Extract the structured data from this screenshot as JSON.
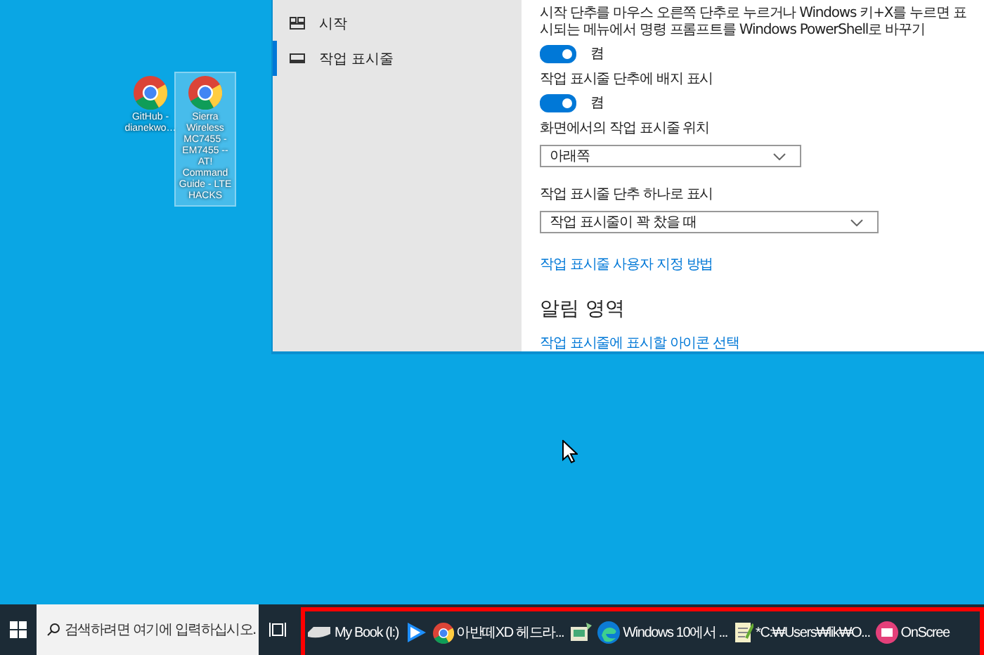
{
  "desktop_icons": [
    {
      "label": "GitHub - dianekwo…",
      "selected": false
    },
    {
      "label": "Sierra Wireless MC7455 - EM7455 -- AT! Command Guide - LTE HACKS",
      "selected": true
    }
  ],
  "settings": {
    "nav": [
      {
        "label": "시작",
        "kind": "start",
        "selected": false
      },
      {
        "label": "작업 표시줄",
        "kind": "taskbar",
        "selected": true
      }
    ],
    "items": [
      {
        "kind": "text",
        "text": "시작 단추를 마우스 오른쪽 단추로 누르거나 Windows 키+X를 누르면 표시되는 메뉴에서 명령 프롬프트를 Windows PowerShell로 바꾸기"
      },
      {
        "kind": "toggle",
        "on": true,
        "label": "켬"
      },
      {
        "kind": "text",
        "text": "작업 표시줄 단추에 배지 표시"
      },
      {
        "kind": "toggle",
        "on": true,
        "label": "켬"
      },
      {
        "kind": "text",
        "text": "화면에서의 작업 표시줄 위치"
      },
      {
        "kind": "dropdown",
        "value": "아래쪽"
      },
      {
        "kind": "text",
        "text": "작업 표시줄 단추 하나로 표시"
      },
      {
        "kind": "dropdown",
        "value": "작업 표시줄이 꽉 찼을 때"
      },
      {
        "kind": "link",
        "text": "작업 표시줄 사용자 지정 방법"
      },
      {
        "kind": "heading",
        "text": "알림 영역"
      },
      {
        "kind": "link",
        "text": "작업 표시줄에 표시할 아이콘 선택"
      }
    ]
  },
  "taskbar": {
    "search": {
      "placeholder": "검색하려면 여기에 입력하십시오."
    },
    "apps": [
      {
        "kind": "drive",
        "label": "My Book (I:)"
      },
      {
        "kind": "player"
      },
      {
        "kind": "chrome",
        "label": "아반떼XD 헤드라..."
      },
      {
        "kind": "tool"
      },
      {
        "kind": "edge",
        "label": "Windows 10에서 ..."
      },
      {
        "kind": "notepad",
        "label": "*C:₩Users₩lik₩O..."
      },
      {
        "kind": "recorder",
        "label": "OnScree"
      }
    ]
  }
}
